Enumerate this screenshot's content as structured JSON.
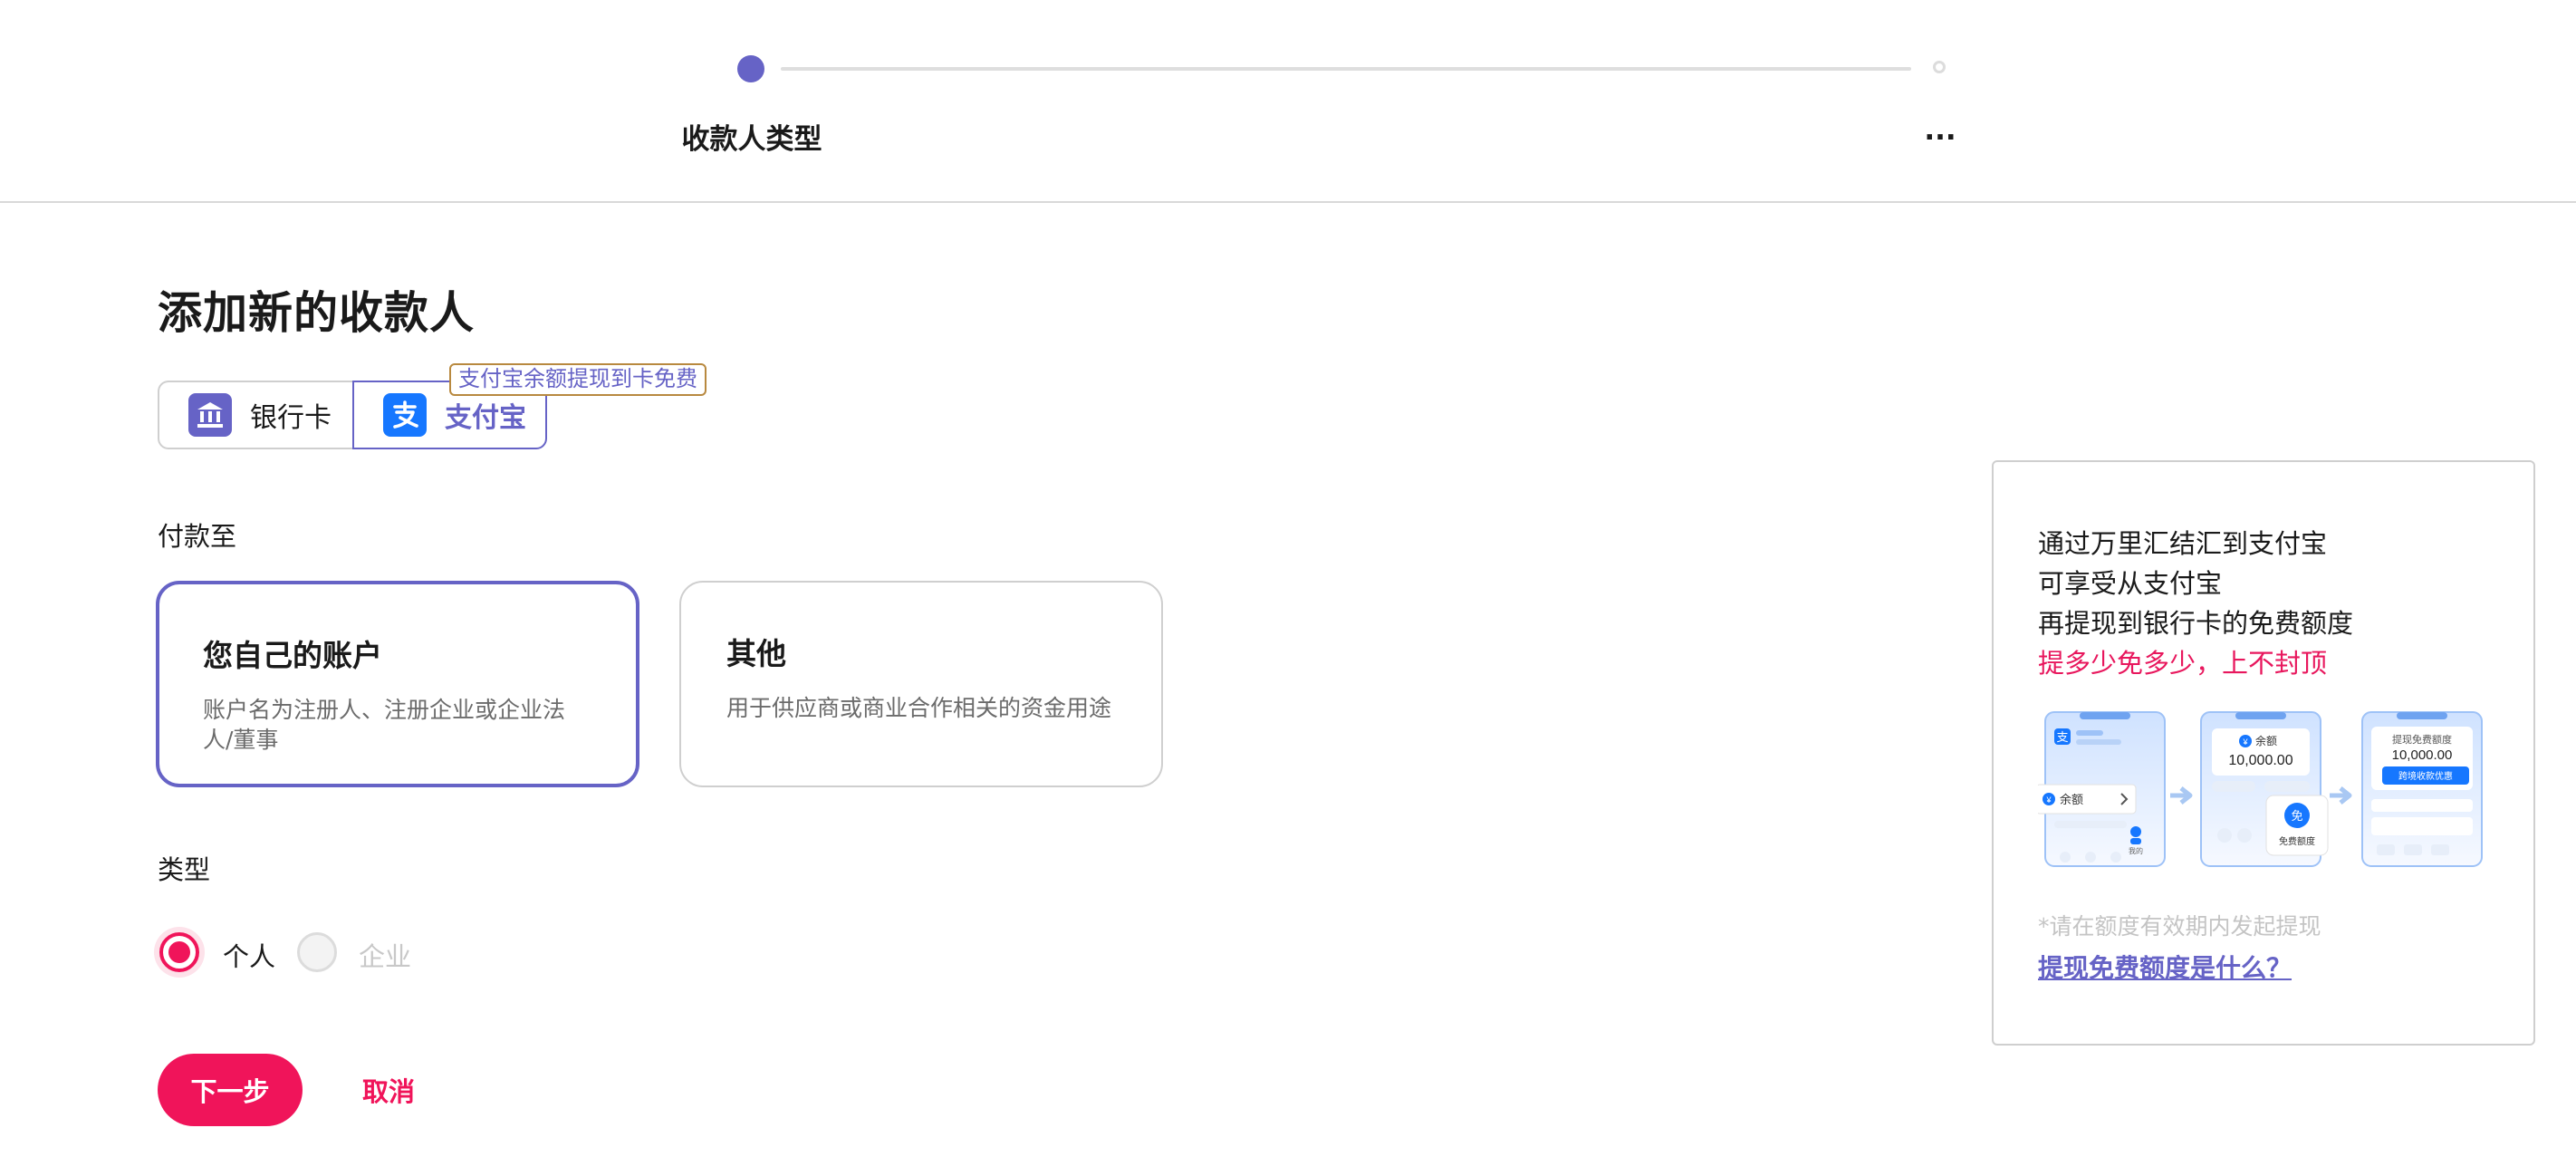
{
  "stepper": {
    "current_step_label": "收款人类型",
    "next_step_label": "..."
  },
  "page": {
    "title": "添加新的收款人"
  },
  "methods": {
    "bank_card_label": "银行卡",
    "alipay_label": "支付宝",
    "promo_badge": "支付宝余额提现到卡免费",
    "selected": "alipay"
  },
  "pay_to": {
    "label": "付款至",
    "options": [
      {
        "title": "您自己的账户",
        "description": "账户名为注册人、注册企业或企业法人/董事",
        "selected": true
      },
      {
        "title": "其他",
        "description": "用于供应商或商业合作相关的资金用途",
        "selected": false
      }
    ]
  },
  "type": {
    "label": "类型",
    "options": [
      {
        "label": "个人",
        "selected": true,
        "disabled": false
      },
      {
        "label": "企业",
        "selected": false,
        "disabled": true
      }
    ]
  },
  "actions": {
    "next_label": "下一步",
    "cancel_label": "取消"
  },
  "info_panel": {
    "lines": [
      "通过万里汇结汇到支付宝",
      "可享受从支付宝",
      "再提现到银行卡的免费额度"
    ],
    "highlight": "提多少免多少，上不封顶",
    "illustration": {
      "phone1_balance_label": "余额",
      "phone1_user_label": "我的",
      "phone2_balance_label": "余额",
      "phone2_amount": "10,000.00",
      "phone2_free_badge": "免",
      "phone2_free_label": "免费额度",
      "phone3_title": "提现免费额度",
      "phone3_amount": "10,000.00",
      "phone3_button": "跨境收款优惠"
    },
    "note": "*请在额度有效期内发起提现",
    "link": "提现免费额度是什么？"
  },
  "colors": {
    "accent_purple": "#6663c6",
    "accent_red": "#f0145a",
    "alipay_blue": "#1677ff"
  }
}
